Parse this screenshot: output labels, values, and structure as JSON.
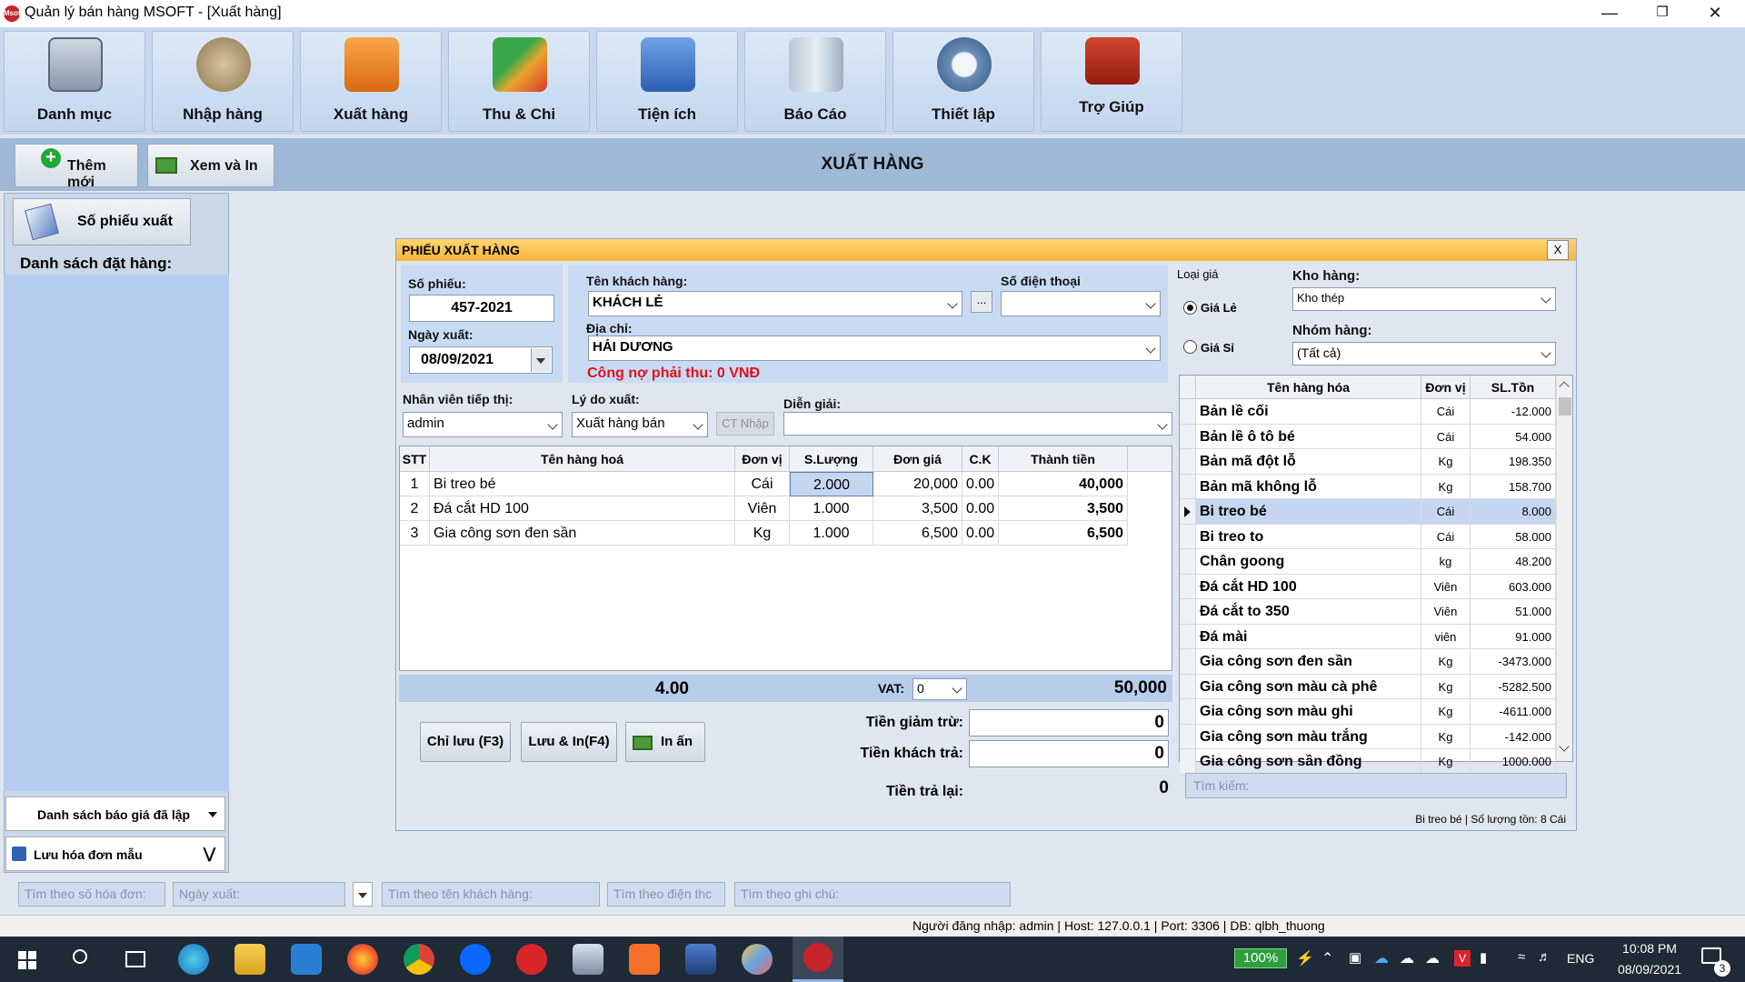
{
  "window": {
    "title": "Quản lý bán hàng MSOFT - [Xuất hàng]",
    "app_icon_text": "Msoft"
  },
  "ribbon": [
    "Danh mục",
    "Nhập hàng",
    "Xuất hàng",
    "Thu & Chi",
    "Tiện ích",
    "Báo Cáo",
    "Thiết lập",
    "Trợ Giúp"
  ],
  "toolbar": {
    "add_label": "Thêm mới",
    "view_print_label": "Xem và In",
    "page_title": "XUẤT HÀNG"
  },
  "left": {
    "so_phieu_label": "Số phiếu xuất",
    "orders_label": "Danh sách đặt hàng:",
    "quotes_label": "Danh sách báo giá đã lập",
    "save_template_label": "Lưu hóa đơn mẫu"
  },
  "dialog": {
    "title": "PHIẾU XUẤT HÀNG",
    "close": "X",
    "so_phieu_label": "Số phiếu:",
    "so_phieu": "457-2021",
    "ngay_xuat_label": "Ngày xuất:",
    "ngay_xuat": "08/09/2021",
    "customer_label": "Tên khách hàng:",
    "customer": "KHÁCH LẺ",
    "more_button": "...",
    "phone_label": "Số điện thoại",
    "phone": "",
    "address_label": "Địa chỉ:",
    "address": "HẢI DƯƠNG",
    "debt": "Công nợ phải thu: 0 VNĐ",
    "staff_label": "Nhân viên tiếp thị:",
    "staff": "admin",
    "reason_label": "Lý do xuất:",
    "reason": "Xuất hàng bán",
    "ct_nhap": "CT Nhập",
    "note_label": "Diễn giải:",
    "note": "",
    "price_type_label": "Loại giá",
    "price_retail": "Giá Lẻ",
    "price_wholesale": "Giá Sỉ",
    "warehouse_label": "Kho hàng:",
    "warehouse": "Kho thép",
    "group_label": "Nhóm hàng:",
    "group": "(Tất cả)"
  },
  "items": {
    "headers": [
      "STT",
      "Tên hàng hoá",
      "Đơn vị",
      "S.Lượng",
      "Đơn giá",
      "C.K",
      "Thành tiền"
    ],
    "rows": [
      [
        "1",
        "Bi treo bé",
        "Cái",
        "2.000",
        "20,000",
        "0.00",
        "40,000"
      ],
      [
        "2",
        "Đá cắt HD 100",
        "Viên",
        "1.000",
        "3,500",
        "0.00",
        "3,500"
      ],
      [
        "3",
        "Gia công sơn đen sần",
        "Kg",
        "1.000",
        "6,500",
        "0.00",
        "6,500"
      ]
    ],
    "total_qty": "4.00",
    "vat_label": "VAT:",
    "vat": "0",
    "total": "50,000"
  },
  "totals": {
    "discount_label": "Tiền giảm trừ:",
    "discount": "0",
    "paid_label": "Tiền khách trả:",
    "paid": "0",
    "change_label": "Tiền trả lại:",
    "change": "0"
  },
  "actions": {
    "save": "Chỉ lưu (F3)",
    "save_print": "Lưu & In(F4)",
    "print": "In ấn"
  },
  "products": {
    "headers": [
      "Tên hàng hóa",
      "Đơn vị",
      "SL.Tồn"
    ],
    "rows": [
      [
        "Bản lề cối",
        "Cái",
        "-12.000"
      ],
      [
        "Bản lề ô tô bé",
        "Cái",
        "54.000"
      ],
      [
        "Bản mã đột lỗ",
        "Kg",
        "198.350"
      ],
      [
        "Bản mã không lỗ",
        "Kg",
        "158.700"
      ],
      [
        "Bi treo bé",
        "Cái",
        "8.000"
      ],
      [
        "Bi treo to",
        "Cái",
        "58.000"
      ],
      [
        "Chân goong",
        "kg",
        "48.200"
      ],
      [
        "Đá cắt HD 100",
        "Viên",
        "603.000"
      ],
      [
        "Đá cắt to 350",
        "Viên",
        "51.000"
      ],
      [
        "Đá mài",
        "viên",
        "91.000"
      ],
      [
        "Gia công sơn đen sần",
        "Kg",
        "-3473.000"
      ],
      [
        "Gia công sơn màu cà phê",
        "Kg",
        "-5282.500"
      ],
      [
        "Gia công sơn màu ghi",
        "Kg",
        "-4611.000"
      ],
      [
        "Gia công sơn màu trắng",
        "Kg",
        "-142.000"
      ],
      [
        "Gia công sơn sần đồng",
        "Kg",
        "1000.000"
      ]
    ],
    "search_placeholder": "Tìm kiếm:",
    "status": "Bi treo bé | Số lượng tồn: 8 Cái"
  },
  "search_bar": {
    "invoice": "Tìm theo số hóa đơn:",
    "date": "Ngày xuất:",
    "customer": "Tìm theo tên khách hàng:",
    "phone": "Tìm theo điện thc",
    "note": "Tìm theo ghi chú:"
  },
  "statusbar": "Người đăng nhập: admin | Host: 127.0.0.1 | Port: 3306 | DB: qlbh_thuong",
  "taskbar": {
    "battery": "100%",
    "lang": "ENG",
    "time": "10:08 PM",
    "date": "08/09/2021",
    "notif": "3"
  },
  "colors": {
    "ribbon": "#c8d8ec",
    "dialog_header": "#f5b53a",
    "selected_row": "#c6d6f0",
    "debt_text": "#e0101a"
  }
}
